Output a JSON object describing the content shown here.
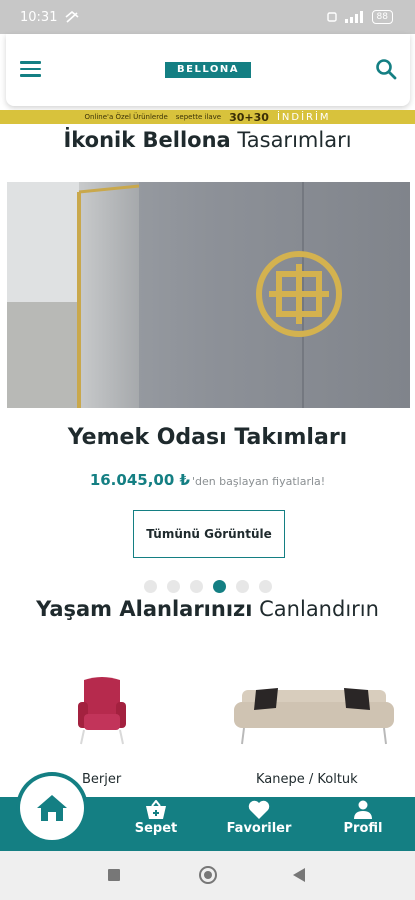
{
  "status_bar": {
    "time": "10:31",
    "battery": "88"
  },
  "header": {
    "logo": "BELLONA"
  },
  "promo": {
    "left_text": "Online'a Özel Ürünlerde",
    "mid_text": "sepette ilave",
    "big": "30+30",
    "right": "İNDİRİM"
  },
  "section1": {
    "title_bold": "İkonik Bellona",
    "title_rest": "Tasarımları"
  },
  "slide": {
    "title": "Yemek Odası Takımları",
    "price": "16.045,00 ₺",
    "price_suffix": "'den başlayan fiyatlarla!",
    "button": "Tümünü Görüntüle",
    "dots_total": 6,
    "active_dot": 4
  },
  "section2": {
    "title_bold": "Yaşam Alanlarınızı",
    "title_rest": "Canlandırın"
  },
  "categories": [
    {
      "label": "Berjer"
    },
    {
      "label": "Kanepe / Koltuk"
    }
  ],
  "bottom_nav": {
    "cart": "Sepet",
    "favorites": "Favoriler",
    "profile": "Profil"
  },
  "colors": {
    "brand": "#147f83",
    "promo": "#d8c23c"
  }
}
